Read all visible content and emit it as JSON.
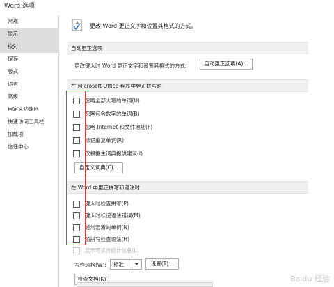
{
  "window": {
    "title": "Word 选项"
  },
  "sidebar": {
    "items": [
      {
        "label": "常规"
      },
      {
        "label": "显示"
      },
      {
        "label": "校对"
      },
      {
        "label": "保存"
      },
      {
        "label": "版式"
      },
      {
        "label": "语言"
      },
      {
        "label": "高级"
      },
      {
        "label": "自定义功能区"
      },
      {
        "label": "快速访问工具栏"
      },
      {
        "label": "加载项"
      },
      {
        "label": "信任中心"
      }
    ]
  },
  "header": {
    "text": "更改 Word 更正文字和设置其格式的方式。"
  },
  "autocorrect": {
    "title": "自动更正选项",
    "description": "更改键入时 Word 更正文字和设置其格式的方式:",
    "button": "自动更正选项(A)..."
  },
  "office_section": {
    "title": "在 Microsoft Office 程序中更正拼写时",
    "options": [
      {
        "label": "忽略全部大写的单词(U)"
      },
      {
        "label": "忽略包含数字的单词(B)"
      },
      {
        "label": "忽略 Internet 和文件地址(F)"
      },
      {
        "label": "标记重复单词(R)"
      },
      {
        "label": "仅根据主词典提供建议(I)"
      }
    ],
    "custom_dict_button": "自定义词典(C)..."
  },
  "word_section": {
    "title": "在 Word 中更正拼写和语法时",
    "options": [
      {
        "label": "键入时检查拼写(P)"
      },
      {
        "label": "键入时标记语法错误(M)"
      },
      {
        "label": "经常混淆的单词(N)"
      },
      {
        "label": "随拼写检查语法(H)"
      },
      {
        "label": "显示可读性统计信息(L)"
      }
    ],
    "writing_style_label": "写作风格(W):",
    "writing_style_value": "标准",
    "settings_button": "设置(T)...",
    "check_doc_button": "检查文档(K)"
  },
  "watermark": "Baidu 经验",
  "colors": {
    "highlight_box": "#e2363a",
    "selected_item": "#dcdcdc"
  }
}
